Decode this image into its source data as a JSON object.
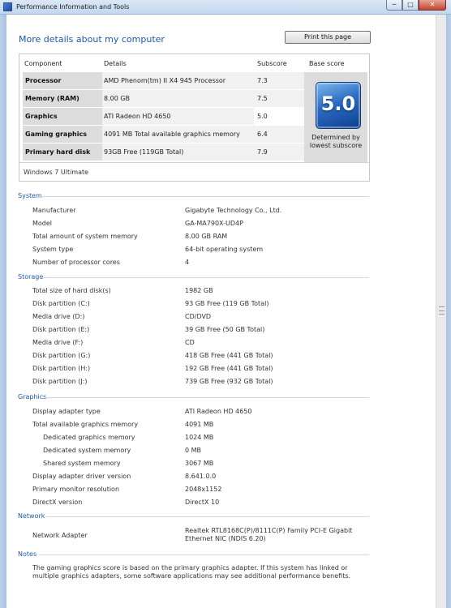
{
  "window": {
    "title": "Performance Information and Tools",
    "buttons": {
      "minimize": "─",
      "maximize": "□",
      "close": "✕"
    }
  },
  "header": {
    "heading": "More details about my computer",
    "print_button": "Print this page"
  },
  "score_table": {
    "columns": [
      "Component",
      "Details",
      "Subscore",
      "Base score"
    ],
    "rows": [
      {
        "component": "Processor",
        "details": "AMD Phenom(tm) II X4 945 Processor",
        "subscore": "7.3"
      },
      {
        "component": "Memory (RAM)",
        "details": "8.00 GB",
        "subscore": "7.5"
      },
      {
        "component": "Graphics",
        "details": "ATI Radeon HD 4650",
        "subscore": "5.0"
      },
      {
        "component": "Gaming graphics",
        "details": "4091 MB Total available graphics memory",
        "subscore": "6.4"
      },
      {
        "component": "Primary hard disk",
        "details": "93GB Free (119GB Total)",
        "subscore": "7.9"
      }
    ],
    "base_score": "5.0",
    "base_caption_1": "Determined by",
    "base_caption_2": "lowest subscore",
    "edition": "Windows 7 Ultimate"
  },
  "system": {
    "title": "System",
    "items": [
      {
        "label": "Manufacturer",
        "value": "Gigabyte Technology Co., Ltd."
      },
      {
        "label": "Model",
        "value": "GA-MA790X-UD4P"
      },
      {
        "label": "Total amount of system memory",
        "value": "8.00 GB RAM"
      },
      {
        "label": "System type",
        "value": "64-bit operating system"
      },
      {
        "label": "Number of processor cores",
        "value": "4"
      }
    ]
  },
  "storage": {
    "title": "Storage",
    "items": [
      {
        "label": "Total size of hard disk(s)",
        "value": "1982 GB"
      },
      {
        "label": "Disk partition (C:)",
        "value": "93 GB Free (119 GB Total)"
      },
      {
        "label": "Media drive (D:)",
        "value": "CD/DVD"
      },
      {
        "label": "Disk partition (E:)",
        "value": "39 GB Free (50 GB Total)"
      },
      {
        "label": "Media drive (F:)",
        "value": "CD"
      },
      {
        "label": "Disk partition (G:)",
        "value": "418 GB Free (441 GB Total)"
      },
      {
        "label": "Disk partition (H:)",
        "value": "192 GB Free (441 GB Total)"
      },
      {
        "label": "Disk partition (J:)",
        "value": "739 GB Free (932 GB Total)"
      }
    ]
  },
  "graphics": {
    "title": "Graphics",
    "items": [
      {
        "label": "Display adapter type",
        "value": "ATI Radeon HD 4650"
      },
      {
        "label": "Total available graphics memory",
        "value": "4091 MB"
      },
      {
        "label": "Dedicated graphics memory",
        "value": "1024 MB"
      },
      {
        "label": "Dedicated system memory",
        "value": "0 MB"
      },
      {
        "label": "Shared system memory",
        "value": "3067 MB"
      },
      {
        "label": "Display adapter driver version",
        "value": "8.641.0.0"
      },
      {
        "label": "Primary monitor resolution",
        "value": "2048x1152"
      },
      {
        "label": "DirectX version",
        "value": "DirectX 10"
      }
    ]
  },
  "network": {
    "title": "Network",
    "items": [
      {
        "label": "Network Adapter",
        "value": "Realtek RTL8168C(P)/8111C(P) Family PCI-E Gigabit Ethernet NIC (NDIS 6.20)"
      }
    ]
  },
  "notes": {
    "title": "Notes",
    "text": "The gaming graphics score is based on the primary graphics adapter. If this system has linked or multiple graphics adapters, some software applications may see additional performance benefits."
  }
}
